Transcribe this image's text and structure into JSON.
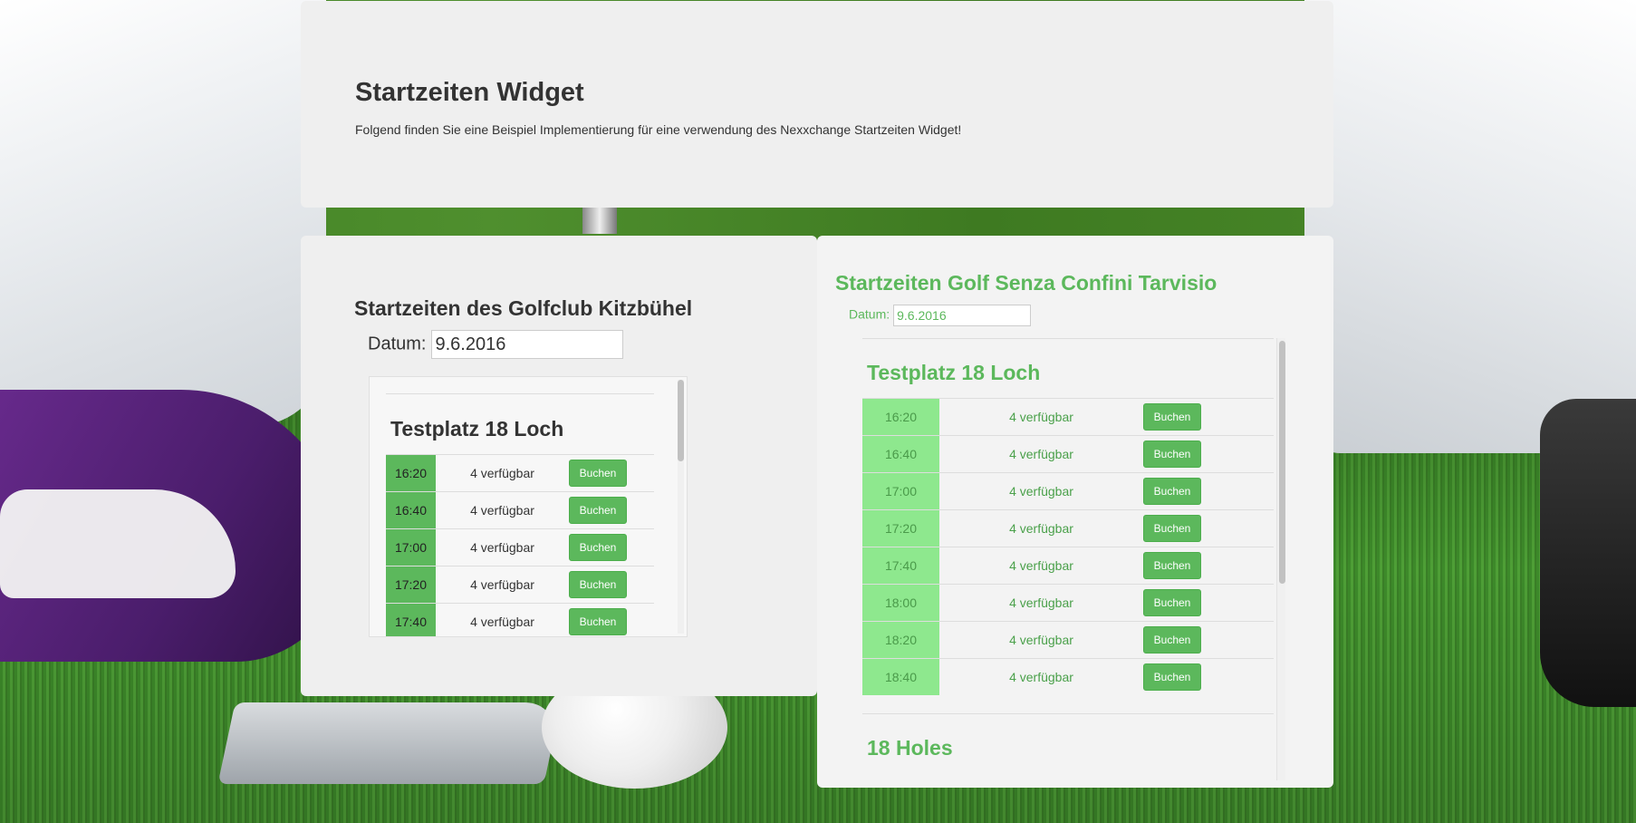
{
  "hero": {
    "title": "Startzeiten Widget",
    "description": "Folgend finden Sie eine Beispiel Implementierung für eine verwendung des Nexxchange Startzeiten Widget!"
  },
  "left_widget": {
    "title": "Startzeiten des Golfclub Kitzbühel",
    "date_label": "Datum:",
    "date_value": "9.6.2016",
    "course": "Testplatz 18 Loch",
    "slots": [
      {
        "time": "16:20",
        "availability": "4 verfügbar",
        "button": "Buchen"
      },
      {
        "time": "16:40",
        "availability": "4 verfügbar",
        "button": "Buchen"
      },
      {
        "time": "17:00",
        "availability": "4 verfügbar",
        "button": "Buchen"
      },
      {
        "time": "17:20",
        "availability": "4 verfügbar",
        "button": "Buchen"
      },
      {
        "time": "17:40",
        "availability": "4 verfügbar",
        "button": "Buchen"
      }
    ]
  },
  "right_widget": {
    "title": "Startzeiten Golf Senza Confini Tarvisio",
    "date_label": "Datum:",
    "date_value": "9.6.2016",
    "course": "Testplatz 18 Loch",
    "slots": [
      {
        "time": "16:20",
        "availability": "4 verfügbar",
        "button": "Buchen"
      },
      {
        "time": "16:40",
        "availability": "4 verfügbar",
        "button": "Buchen"
      },
      {
        "time": "17:00",
        "availability": "4 verfügbar",
        "button": "Buchen"
      },
      {
        "time": "17:20",
        "availability": "4 verfügbar",
        "button": "Buchen"
      },
      {
        "time": "17:40",
        "availability": "4 verfügbar",
        "button": "Buchen"
      },
      {
        "time": "18:00",
        "availability": "4 verfügbar",
        "button": "Buchen"
      },
      {
        "time": "18:20",
        "availability": "4 verfügbar",
        "button": "Buchen"
      },
      {
        "time": "18:40",
        "availability": "4 verfügbar",
        "button": "Buchen"
      }
    ],
    "second_course": "18 Holes"
  },
  "colors": {
    "accent_green": "#5cb85c",
    "light_green": "#8ee88e",
    "panel_bg": "#efefef"
  }
}
